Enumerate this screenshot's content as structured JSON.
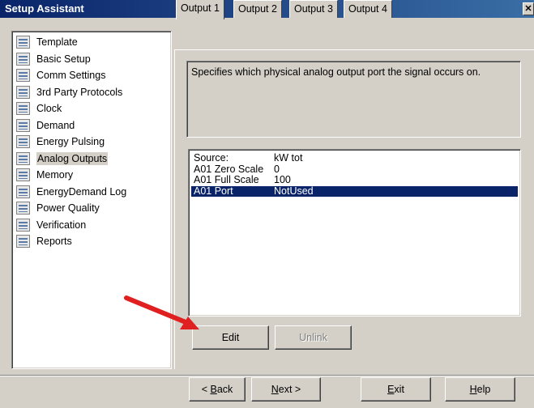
{
  "window": {
    "title": "Setup Assistant",
    "close_glyph": "✕"
  },
  "sidebar": {
    "items": [
      {
        "label": "Template",
        "icon": "page-list-icon"
      },
      {
        "label": "Basic Setup",
        "icon": "page-list-icon"
      },
      {
        "label": "Comm Settings",
        "icon": "page-list-icon"
      },
      {
        "label": "3rd Party Protocols",
        "icon": "page-list-icon"
      },
      {
        "label": "Clock",
        "icon": "page-list-icon"
      },
      {
        "label": "Demand",
        "icon": "page-list-icon"
      },
      {
        "label": "Energy Pulsing",
        "icon": "page-list-icon"
      },
      {
        "label": "Analog Outputs",
        "icon": "page-list-icon",
        "selected": true
      },
      {
        "label": "Memory",
        "icon": "page-list-icon"
      },
      {
        "label": "EnergyDemand Log",
        "icon": "page-list-icon"
      },
      {
        "label": "Power Quality",
        "icon": "page-list-icon"
      },
      {
        "label": "Verification",
        "icon": "page-list-icon"
      },
      {
        "label": "Reports",
        "icon": "page-list-icon"
      }
    ]
  },
  "tabs": [
    {
      "label": "Output 1",
      "active": true
    },
    {
      "label": "Output 2"
    },
    {
      "label": "Output 3"
    },
    {
      "label": "Output 4"
    }
  ],
  "description": "Specifies which physical analog output port the signal occurs on.",
  "parameters": [
    {
      "key": "Source:",
      "value": "kW tot"
    },
    {
      "key": "A01 Zero Scale",
      "value": "0"
    },
    {
      "key": "A01 Full Scale",
      "value": "100"
    },
    {
      "key": "A01 Port",
      "value": "NotUsed",
      "selected": true
    }
  ],
  "actions": {
    "edit": "Edit",
    "unlink": "Unlink"
  },
  "footer": {
    "back": {
      "prefix": "< ",
      "mnemonic": "B",
      "rest": "ack"
    },
    "next": {
      "mnemonic": "N",
      "rest": "ext >"
    },
    "exit": {
      "mnemonic": "E",
      "rest": "xit"
    },
    "help": {
      "mnemonic": "H",
      "rest": "elp"
    }
  },
  "colors": {
    "title_bar": "#0a246a",
    "selection": "#0a246a",
    "annotation_arrow": "#e02020",
    "face": "#d4d0c8"
  }
}
